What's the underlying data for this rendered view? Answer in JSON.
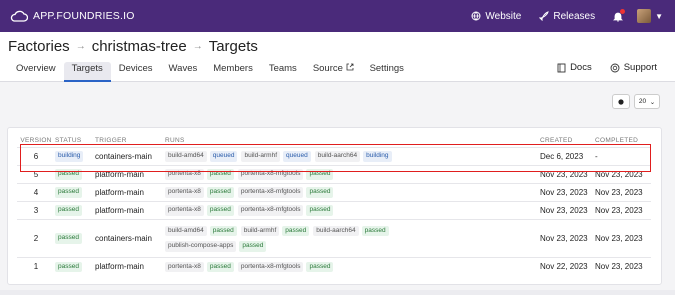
{
  "topbar": {
    "brand": "APP.FOUNDRIES.IO",
    "website": "Website",
    "releases": "Releases"
  },
  "breadcrumb": {
    "items": [
      "Factories",
      "christmas-tree",
      "Targets"
    ]
  },
  "tabs": [
    "Overview",
    "Targets",
    "Devices",
    "Waves",
    "Members",
    "Teams",
    "Source",
    "Settings"
  ],
  "tabs_right": {
    "docs": "Docs",
    "support": "Support"
  },
  "toolbar": {
    "per_page": "20"
  },
  "table": {
    "headers": {
      "version": "VERSION",
      "status": "STATUS",
      "trigger": "TRIGGER",
      "runs": "RUNS",
      "created": "CREATED",
      "completed": "COMPLETED"
    },
    "rows": [
      {
        "version": "6",
        "status": "building",
        "trigger": "containers-main",
        "runs": [
          {
            "name": "build-amd64",
            "state": "queued"
          },
          {
            "name": "build-armhf",
            "state": "queued"
          },
          {
            "name": "build-aarch64",
            "state": "building"
          }
        ],
        "created": "Dec 6, 2023",
        "completed": "-"
      },
      {
        "version": "5",
        "status": "passed",
        "trigger": "platform-main",
        "runs": [
          {
            "name": "portenta-x8",
            "state": "passed"
          },
          {
            "name": "portenta-x8-mfgtools",
            "state": "passed"
          }
        ],
        "created": "Nov 23, 2023",
        "completed": "Nov 23, 2023"
      },
      {
        "version": "4",
        "status": "passed",
        "trigger": "platform-main",
        "runs": [
          {
            "name": "portenta-x8",
            "state": "passed"
          },
          {
            "name": "portenta-x8-mfgtools",
            "state": "passed"
          }
        ],
        "created": "Nov 23, 2023",
        "completed": "Nov 23, 2023"
      },
      {
        "version": "3",
        "status": "passed",
        "trigger": "platform-main",
        "runs": [
          {
            "name": "portenta-x8",
            "state": "passed"
          },
          {
            "name": "portenta-x8-mfgtools",
            "state": "passed"
          }
        ],
        "created": "Nov 23, 2023",
        "completed": "Nov 23, 2023"
      },
      {
        "version": "2",
        "status": "passed",
        "trigger": "containers-main",
        "runs": [
          {
            "name": "build-amd64",
            "state": "passed"
          },
          {
            "name": "build-armhf",
            "state": "passed"
          },
          {
            "name": "build-aarch64",
            "state": "passed"
          },
          {
            "name": "publish-compose-apps",
            "state": "passed"
          }
        ],
        "created": "Nov 23, 2023",
        "completed": "Nov 23, 2023"
      },
      {
        "version": "1",
        "status": "passed",
        "trigger": "platform-main",
        "runs": [
          {
            "name": "portenta-x8",
            "state": "passed"
          },
          {
            "name": "portenta-x8-mfgtools",
            "state": "passed"
          }
        ],
        "created": "Nov 22, 2023",
        "completed": "Nov 23, 2023"
      }
    ]
  },
  "colors": {
    "topbar": "#4a2a7a",
    "accent": "#2a63c6",
    "highlight": "#e01e1e",
    "passed": "#2b7a3a",
    "building": "#2a5caa"
  },
  "icons": [
    "cloud-logo-icon",
    "globe-icon",
    "rocket-icon",
    "bell-icon",
    "book-icon",
    "lifebuoy-icon",
    "external-link-icon",
    "chevron-down-icon"
  ]
}
